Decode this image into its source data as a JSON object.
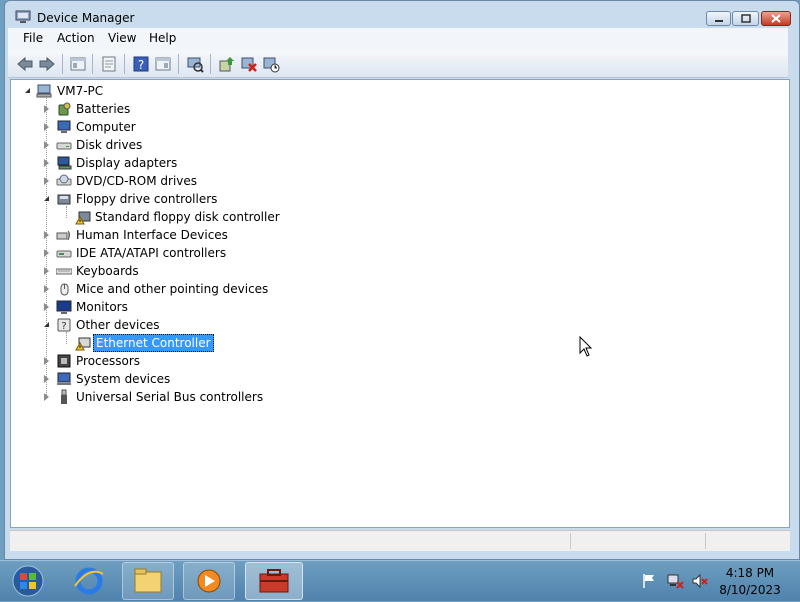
{
  "window": {
    "title": "Device Manager"
  },
  "menu": [
    "File",
    "Action",
    "View",
    "Help"
  ],
  "toolbar": {
    "icons": [
      "back-icon",
      "forward-icon",
      "up-icon",
      "properties-icon",
      "help-icon",
      "view-icon",
      "scan-icon",
      "update-driver-icon",
      "uninstall-icon",
      "enable-icon"
    ]
  },
  "tree": {
    "root": "VM7-PC",
    "nodes": [
      {
        "label": "Batteries",
        "icon": "battery-icon",
        "expanded": false
      },
      {
        "label": "Computer",
        "icon": "computer-icon",
        "expanded": false
      },
      {
        "label": "Disk drives",
        "icon": "disk-drive-icon",
        "expanded": false
      },
      {
        "label": "Display adapters",
        "icon": "display-adapter-icon",
        "expanded": false
      },
      {
        "label": "DVD/CD-ROM drives",
        "icon": "dvd-drive-icon",
        "expanded": false
      },
      {
        "label": "Floppy drive controllers",
        "icon": "floppy-controller-icon",
        "expanded": true,
        "children": [
          {
            "label": "Standard floppy disk controller",
            "icon": "warning-device-icon"
          }
        ]
      },
      {
        "label": "Human Interface Devices",
        "icon": "hid-icon",
        "expanded": false
      },
      {
        "label": "IDE ATA/ATAPI controllers",
        "icon": "ide-controller-icon",
        "expanded": false
      },
      {
        "label": "Keyboards",
        "icon": "keyboard-icon",
        "expanded": false
      },
      {
        "label": "Mice and other pointing devices",
        "icon": "mouse-icon",
        "expanded": false
      },
      {
        "label": "Monitors",
        "icon": "monitor-icon",
        "expanded": false
      },
      {
        "label": "Other devices",
        "icon": "unknown-device-icon",
        "expanded": true,
        "children": [
          {
            "label": "Ethernet Controller",
            "icon": "warning-device-icon",
            "selected": true
          }
        ]
      },
      {
        "label": "Processors",
        "icon": "processor-icon",
        "expanded": false
      },
      {
        "label": "System devices",
        "icon": "system-device-icon",
        "expanded": false
      },
      {
        "label": "Universal Serial Bus controllers",
        "icon": "usb-icon",
        "expanded": false
      }
    ]
  },
  "taskbar": {
    "items": [
      "start-orb-icon",
      "internet-explorer-icon",
      "windows-explorer-icon",
      "media-player-icon",
      "device-manager-icon"
    ],
    "tray_icons": [
      "action-center-flag-icon",
      "network-disconnected-icon",
      "volume-muted-icon"
    ],
    "time": "4:18 PM",
    "date": "8/10/2023"
  },
  "colors": {
    "selection": "#3399ff",
    "taskbar": "#5a8db7",
    "close_button": "#c43b22"
  }
}
